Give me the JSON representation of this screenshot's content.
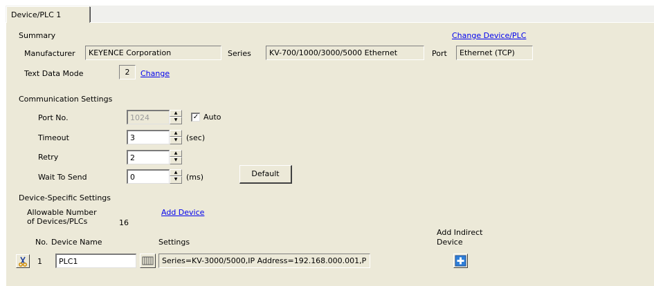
{
  "tab": {
    "label": "Device/PLC 1"
  },
  "summary": {
    "heading": "Summary",
    "change_device_link": "Change Device/PLC",
    "manufacturer_label": "Manufacturer",
    "manufacturer_value": "KEYENCE Corporation",
    "series_label": "Series",
    "series_value": "KV-700/1000/3000/5000 Ethernet",
    "port_label": "Port",
    "port_value": "Ethernet (TCP)",
    "text_mode_label": "Text Data Mode",
    "text_mode_value": "2",
    "text_mode_change_link": "Change"
  },
  "comm": {
    "heading": "Communication Settings",
    "port_no_label": "Port No.",
    "port_no_value": "1024",
    "auto_label": "Auto",
    "auto_checked": true,
    "timeout_label": "Timeout",
    "timeout_value": "3",
    "timeout_unit": "(sec)",
    "retry_label": "Retry",
    "retry_value": "2",
    "wait_label": "Wait To Send",
    "wait_value": "0",
    "wait_unit": "(ms)",
    "default_button": "Default"
  },
  "device_specific": {
    "heading": "Device-Specific Settings",
    "allowable_line1": "Allowable Number",
    "allowable_line2": "of Devices/PLCs",
    "allowable_count": "16",
    "add_device_link": "Add Device",
    "col_no": "No.",
    "col_device_name": "Device Name",
    "col_settings": "Settings",
    "col_add_indirect_line1": "Add Indirect",
    "col_add_indirect_line2": "Device",
    "rows": [
      {
        "no": "1",
        "device_name": "PLC1",
        "settings": "Series=KV-3000/5000,IP Address=192.168.000.001,P"
      }
    ]
  },
  "icons": {
    "delete": "scissors-icon",
    "settings": "settings-grid-icon",
    "add_indirect": "plus-icon",
    "spin_up": "spin-up-arrow-icon",
    "spin_down": "spin-down-arrow-icon",
    "check": "checkmark-icon"
  },
  "colors": {
    "panel_bg": "#ece9d8",
    "link": "#0000ee",
    "add_icon_blue": "#2f7fd8"
  }
}
